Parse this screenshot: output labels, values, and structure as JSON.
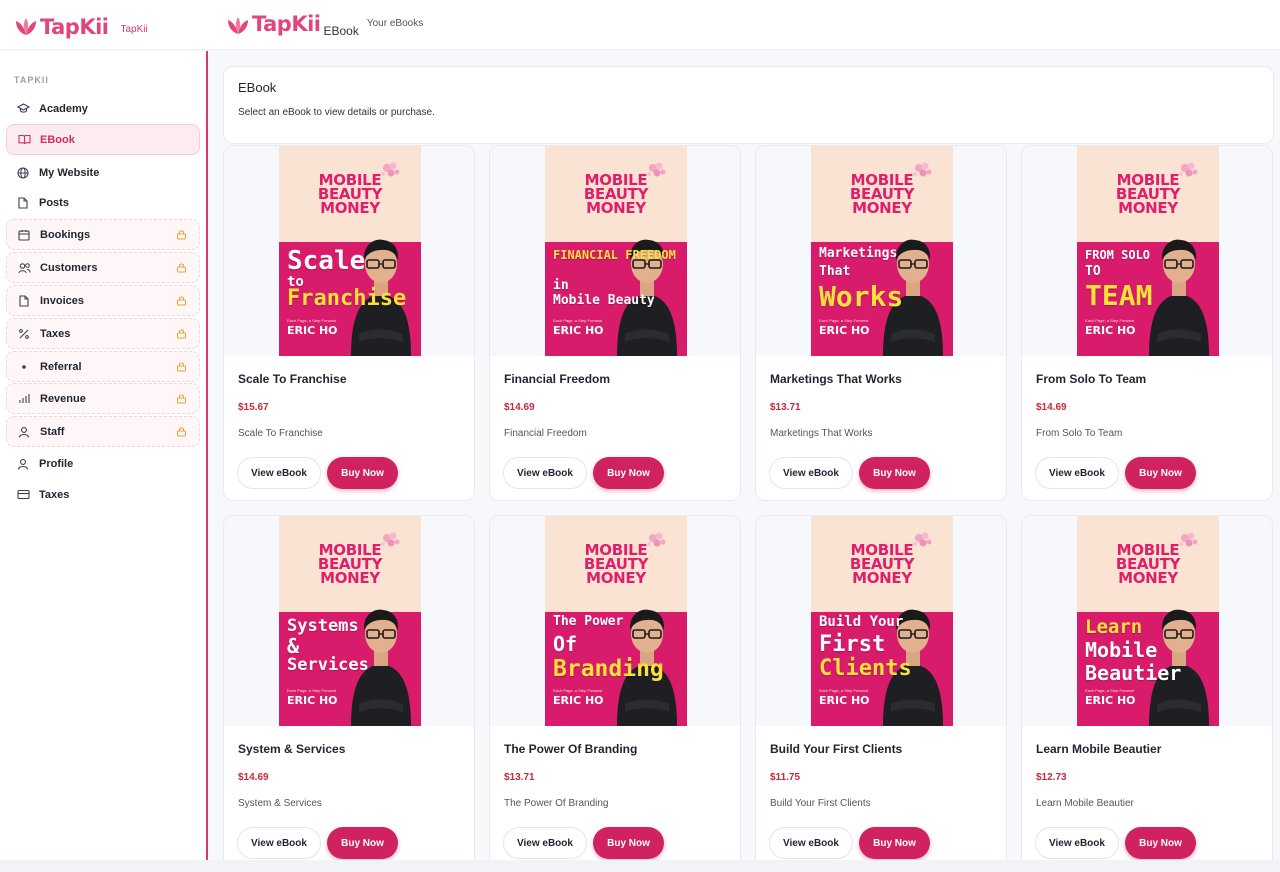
{
  "brand": {
    "logo_text": "TapKii",
    "sidebar_sub": "TapKii",
    "header_sub": "EBook",
    "header_caption": "Your eBooks",
    "color": "#e0457b"
  },
  "sidebar": {
    "section_label": "TAPKII",
    "items": [
      {
        "label": "Academy",
        "icon": "graduation-cap-icon",
        "state": "normal"
      },
      {
        "label": "EBook",
        "icon": "book-icon",
        "state": "active"
      },
      {
        "label": "My Website",
        "icon": "globe-icon",
        "state": "normal"
      },
      {
        "label": "Posts",
        "icon": "file-icon",
        "state": "normal"
      },
      {
        "label": "Bookings",
        "icon": "calendar-icon",
        "state": "locked"
      },
      {
        "label": "Customers",
        "icon": "users-icon",
        "state": "locked"
      },
      {
        "label": "Invoices",
        "icon": "file-icon",
        "state": "locked"
      },
      {
        "label": "Taxes",
        "icon": "percent-icon",
        "state": "locked"
      },
      {
        "label": "Referral",
        "icon": "dot-icon",
        "state": "locked"
      },
      {
        "label": "Revenue",
        "icon": "bar-chart-icon",
        "state": "locked"
      },
      {
        "label": "Staff",
        "icon": "user-icon",
        "state": "locked"
      },
      {
        "label": "Profile",
        "icon": "user-icon",
        "state": "normal"
      },
      {
        "label": "Taxes",
        "icon": "credit-card-icon",
        "state": "normal"
      }
    ],
    "accent": "#d8386d"
  },
  "main": {
    "title": "EBook",
    "description": "Select an eBook to view details or purchase.",
    "view_label": "View eBook",
    "buy_label": "Buy Now",
    "cover_series": [
      "MOBILE",
      "BEAUTY",
      "MONEY"
    ],
    "cover_tagline": "Each Page, a Step Forward",
    "cover_author": "ERIC HO",
    "books": [
      {
        "title": "Scale To Franchise",
        "price": "$15.67",
        "description": "Scale To Franchise",
        "cover_lines": [
          "Scale",
          "to",
          "Franchise"
        ]
      },
      {
        "title": "Financial Freedom",
        "price": "$14.69",
        "description": "Financial Freedom",
        "cover_lines": [
          "FINANCIAL FREEDOM",
          "in",
          "Mobile Beauty"
        ]
      },
      {
        "title": "Marketings That Works",
        "price": "$13.71",
        "description": "Marketings That Works",
        "cover_lines": [
          "Marketings",
          "That",
          "Works"
        ]
      },
      {
        "title": "From Solo To Team",
        "price": "$14.69",
        "description": "From Solo To Team",
        "cover_lines": [
          "FROM SOLO",
          "TO",
          "TEAM"
        ]
      },
      {
        "title": "System & Services",
        "price": "$14.69",
        "description": "System & Services",
        "cover_lines": [
          "Systems",
          "&",
          "Services"
        ]
      },
      {
        "title": "The Power Of Branding",
        "price": "$13.71",
        "description": "The Power Of Branding",
        "cover_lines": [
          "The Power",
          "Of",
          "Branding"
        ]
      },
      {
        "title": "Build Your First Clients",
        "price": "$11.75",
        "description": "Build Your First Clients",
        "cover_lines": [
          "Build Your",
          "First",
          "Clients"
        ]
      },
      {
        "title": "Learn Mobile Beautier",
        "price": "$12.73",
        "description": "Learn Mobile Beautier",
        "cover_lines": [
          "Learn",
          "Mobile",
          "Beautier"
        ]
      }
    ]
  }
}
